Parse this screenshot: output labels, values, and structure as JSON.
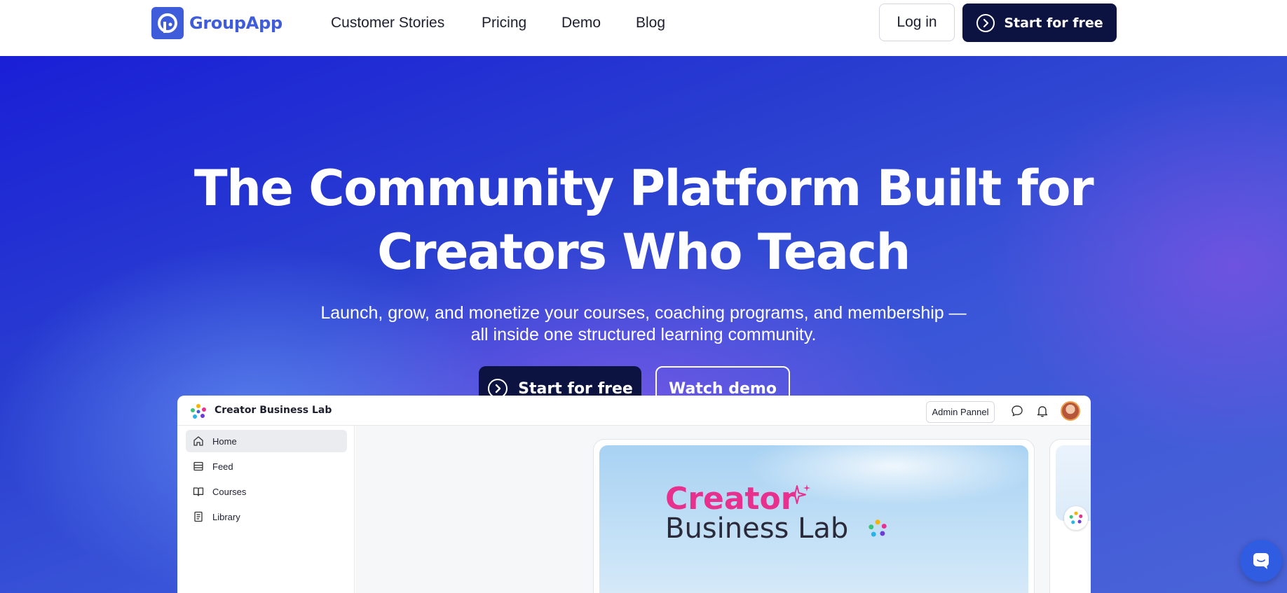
{
  "nav": {
    "brand": "GroupApp",
    "links": [
      "Customer Stories",
      "Pricing",
      "Demo",
      "Blog"
    ],
    "login_label": "Log in",
    "start_label": "Start for free"
  },
  "hero": {
    "title_line1": "The Community Platform Built for",
    "title_line2": "Creators Who Teach",
    "subtitle_line1": "Launch, grow, and monetize your courses, coaching programs, and membership —",
    "subtitle_line2": "all inside one structured learning community.",
    "start_label": "Start for free",
    "demo_label": "Watch demo"
  },
  "mockup": {
    "brand": "Creator Business Lab",
    "admin_label": "Admin Pannel",
    "sidebar": [
      {
        "label": "Home",
        "icon": "home-icon",
        "active": true
      },
      {
        "label": "Feed",
        "icon": "feed-icon",
        "active": false
      },
      {
        "label": "Courses",
        "icon": "book-icon",
        "active": false
      },
      {
        "label": "Library",
        "icon": "library-icon",
        "active": false
      }
    ],
    "banner_title": "Creator",
    "banner_subtitle": "Business Lab"
  },
  "colors": {
    "brand_blue": "#3f5ddb",
    "navy": "#0c1340",
    "banner_pink": "#e8318e"
  }
}
